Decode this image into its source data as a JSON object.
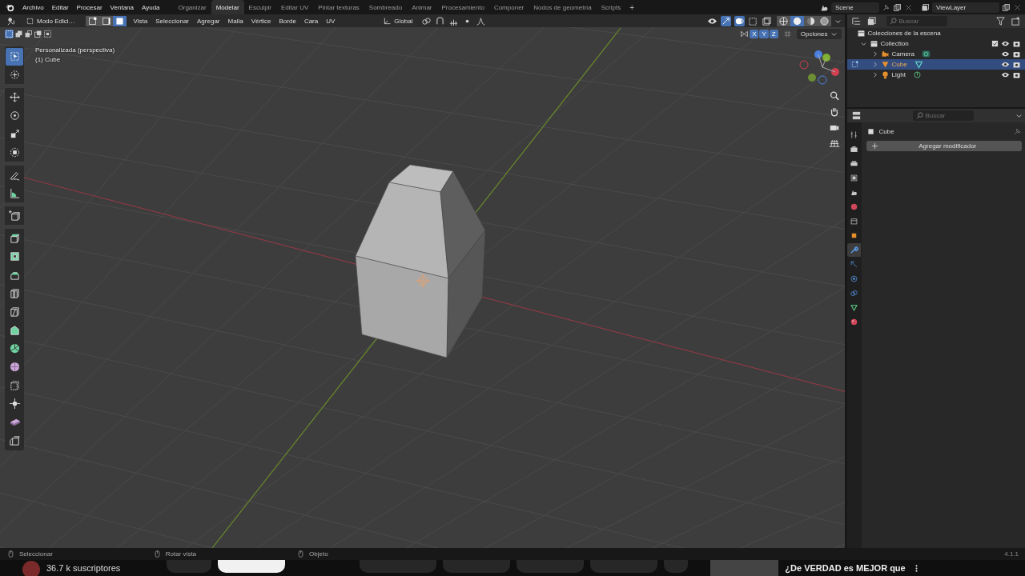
{
  "top_bar": {
    "menus": [
      "Archivo",
      "Editar",
      "Procesar",
      "Ventana",
      "Ayuda"
    ],
    "workspaces": [
      {
        "label": "Organizar",
        "selected": false
      },
      {
        "label": "Modelar",
        "selected": true
      },
      {
        "label": "Esculpir",
        "selected": false
      },
      {
        "label": "Editar UV",
        "selected": false
      },
      {
        "label": "Pintar texturas",
        "selected": false
      },
      {
        "label": "Sombreado",
        "selected": false
      },
      {
        "label": "Animar",
        "selected": false
      },
      {
        "label": "Procesamiento",
        "selected": false
      },
      {
        "label": "Componer",
        "selected": false
      },
      {
        "label": "Nodos de geometría",
        "selected": false
      },
      {
        "label": "Scripts",
        "selected": false
      }
    ],
    "add_workspace": "+",
    "scene": "Scene",
    "view_layer": "ViewLayer"
  },
  "viewport": {
    "mode": "Modo Edici…",
    "select_modes": [
      {
        "kind": "vertex",
        "selected": false
      },
      {
        "kind": "edge",
        "selected": false
      },
      {
        "kind": "face",
        "selected": true
      }
    ],
    "menus": [
      "Vista",
      "Seleccionar",
      "Agregar",
      "Malla",
      "Vértice",
      "Borde",
      "Cara",
      "UV"
    ],
    "orientation": "Global",
    "shading": [
      {
        "kind": "wireframe",
        "selected": false
      },
      {
        "kind": "solid",
        "selected": true
      },
      {
        "kind": "material",
        "selected": false
      },
      {
        "kind": "rendered",
        "selected": false
      }
    ],
    "mirror_axes": [
      {
        "label": "X",
        "on": true
      },
      {
        "label": "Y",
        "on": true
      },
      {
        "label": "Z",
        "on": true
      }
    ],
    "options": "Opciones",
    "view_name": "Personalizada (perspectiva)",
    "object_label": "(1) Cube",
    "tools": [
      {
        "kind": "select",
        "selected": true
      },
      {
        "kind": "cursor",
        "selected": false
      },
      {
        "kind": "move",
        "selected": false
      },
      {
        "kind": "rotate",
        "selected": false
      },
      {
        "kind": "scale",
        "selected": false
      },
      {
        "kind": "transform",
        "selected": false
      },
      {
        "kind": "annotate",
        "selected": false
      },
      {
        "kind": "measure",
        "selected": false
      },
      {
        "kind": "add-cube",
        "selected": false
      },
      {
        "kind": "extrude",
        "selected": false
      },
      {
        "kind": "inset",
        "selected": false
      },
      {
        "kind": "bevel",
        "selected": false
      },
      {
        "kind": "loop-cut",
        "selected": false
      },
      {
        "kind": "knife",
        "selected": false
      },
      {
        "kind": "poly-build",
        "selected": false
      },
      {
        "kind": "spin",
        "selected": false
      },
      {
        "kind": "smooth",
        "selected": false
      },
      {
        "kind": "shrink",
        "selected": false
      },
      {
        "kind": "push",
        "selected": false
      },
      {
        "kind": "shear",
        "selected": false
      },
      {
        "kind": "rip",
        "selected": false
      }
    ]
  },
  "outliner": {
    "search_placeholder": "Buscar",
    "tree": {
      "label": "Colecciones de la escena",
      "children": [
        {
          "label": "Collection",
          "kind": "collection",
          "expanded": true,
          "selected": false,
          "children": [
            {
              "label": "Camera",
              "kind": "camera",
              "expanded": false,
              "selected": false
            },
            {
              "label": "Cube",
              "kind": "mesh",
              "expanded": false,
              "selected": true
            },
            {
              "label": "Light",
              "kind": "light",
              "expanded": false,
              "selected": false
            }
          ]
        }
      ]
    }
  },
  "properties": {
    "search_placeholder": "Buscar",
    "object_name": "Cube",
    "add_modifier": "Agregar modificador",
    "tabs": [
      {
        "kind": "tool",
        "selected": false
      },
      {
        "kind": "render",
        "selected": false
      },
      {
        "kind": "output",
        "selected": false
      },
      {
        "kind": "view-layer",
        "selected": false
      },
      {
        "kind": "scene",
        "selected": false
      },
      {
        "kind": "world",
        "selected": false
      },
      {
        "kind": "collection",
        "selected": false
      },
      {
        "kind": "object",
        "selected": false
      },
      {
        "kind": "modifier",
        "selected": true
      },
      {
        "kind": "particles",
        "selected": false
      },
      {
        "kind": "physics",
        "selected": false
      },
      {
        "kind": "constraints",
        "selected": false
      },
      {
        "kind": "data",
        "selected": false
      },
      {
        "kind": "material",
        "selected": false
      }
    ]
  },
  "status_bar": {
    "hints": [
      "Seleccionar",
      "Rotar vista",
      "Objeto"
    ],
    "version": "4.1.1"
  },
  "video_page": {
    "subscribers": "36.7 k suscriptores",
    "recommendation_title": "¿De VERDAD es MEJOR que"
  }
}
